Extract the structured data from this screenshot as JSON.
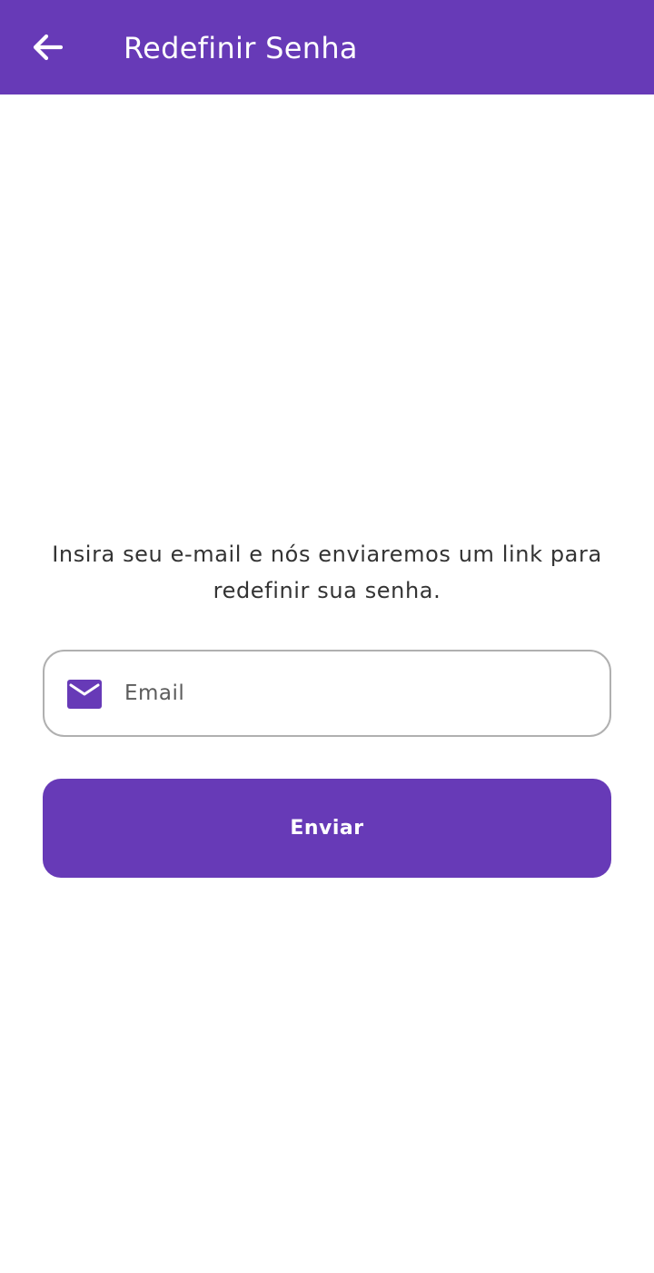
{
  "colors": {
    "primary": "#673ab7",
    "on_primary": "#ffffff",
    "text": "#333333",
    "field_border": "#b0b0b0"
  },
  "app_bar": {
    "back_icon": "arrow-back-icon",
    "title": "Redefinir Senha"
  },
  "form": {
    "instructions": "Insira seu e-mail e nós enviaremos um link para redefinir sua senha.",
    "email": {
      "icon": "mail-icon",
      "placeholder": "Email",
      "value": ""
    },
    "submit_label": "Enviar"
  }
}
